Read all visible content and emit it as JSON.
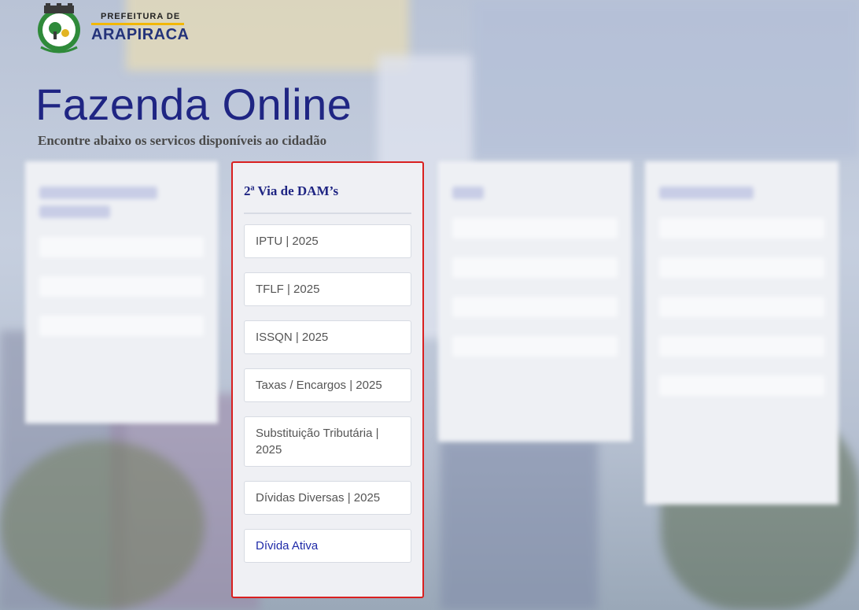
{
  "header": {
    "logo_pre": "PREFEITURA DE",
    "logo_name": "ARAPIRACA",
    "seal_text": "ARAPIRACA"
  },
  "title": "Fazenda Online",
  "subtitle": "Encontre abaixo os servicos disponíveis ao cidadão",
  "dam_card": {
    "title": "2ª Via de DAM’s",
    "items": [
      "IPTU | 2025",
      "TFLF | 2025",
      "ISSQN | 2025",
      "Taxas / Encargos | 2025",
      "Substituição Tributária | 2025",
      "Dívidas Diversas | 2025",
      "Dívida Ativa"
    ]
  },
  "colors": {
    "title": "#1f2583",
    "highlight_border": "#d92020",
    "link": "#1f2aa8"
  }
}
